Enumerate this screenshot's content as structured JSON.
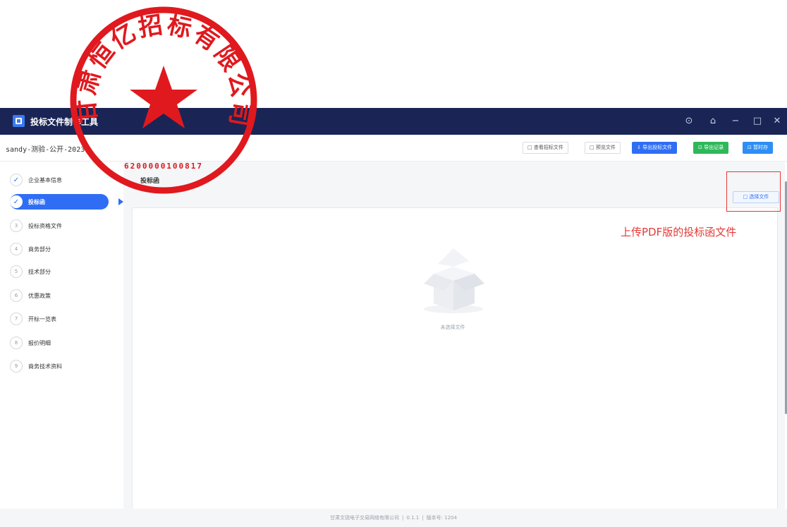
{
  "window": {
    "title": "投标文件制作工具",
    "controls": [
      "⊙",
      "⌂",
      "−",
      "□",
      "✕"
    ]
  },
  "toolbar": {
    "project_name": "sandy-测验-公开-2023",
    "buttons": [
      {
        "label": "□ 查看招标文件",
        "style": "outline"
      },
      {
        "label": "□ 预览文件",
        "style": "outline"
      },
      {
        "label": "⇩ 导出投标文件",
        "style": "blue"
      },
      {
        "label": "⊡ 导出记录",
        "style": "green"
      },
      {
        "label": "⊡ 暂时存",
        "style": "blue2"
      }
    ]
  },
  "sidebar": {
    "steps": [
      {
        "num": "✓",
        "label": "企业基本信息",
        "state": "done"
      },
      {
        "num": "✓",
        "label": "投标函",
        "state": "active"
      },
      {
        "num": "3",
        "label": "投标资格文件",
        "state": "todo"
      },
      {
        "num": "4",
        "label": "商务部分",
        "state": "todo"
      },
      {
        "num": "5",
        "label": "技术部分",
        "state": "todo"
      },
      {
        "num": "6",
        "label": "优惠政策",
        "state": "todo"
      },
      {
        "num": "7",
        "label": "开标一览表",
        "state": "todo"
      },
      {
        "num": "8",
        "label": "报价明细",
        "state": "todo"
      },
      {
        "num": "9",
        "label": "商务技术资料",
        "state": "todo"
      }
    ]
  },
  "main": {
    "section_title": "投标函",
    "select_file_label": "□ 选择文件",
    "annotation": "上传PDF版的投标函文件",
    "empty_text": "未选择文件"
  },
  "footer": {
    "company": "甘肃文锐电子交易网络有限公司",
    "version": "0.1.1",
    "build": "版本号: 1204"
  },
  "seal": {
    "text": "甘肃恒亿招标有限公司",
    "color": "#e0191e",
    "code": "6200000100817"
  },
  "colors": {
    "titlebar": "#1a2556",
    "accent": "#2f6ef4",
    "success": "#2fb85a",
    "annotation": "#e53935"
  }
}
